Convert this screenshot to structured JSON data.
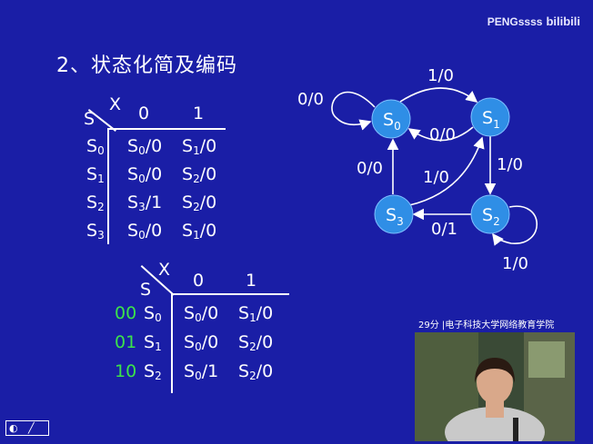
{
  "slide": {
    "title": "2、状态化简及编码",
    "watermark": {
      "text": "PENGssss",
      "logo": "bilibili"
    }
  },
  "table1": {
    "col_var": "X",
    "row_var": "S",
    "columns": [
      "0",
      "1"
    ],
    "rows": [
      {
        "state": "S",
        "state_sub": "0",
        "c0": "S",
        "c0_sub": "0",
        "c0_out": "/0",
        "c1": "S",
        "c1_sub": "1",
        "c1_out": "/0"
      },
      {
        "state": "S",
        "state_sub": "1",
        "c0": "S",
        "c0_sub": "0",
        "c0_out": "/0",
        "c1": "S",
        "c1_sub": "2",
        "c1_out": "/0"
      },
      {
        "state": "S",
        "state_sub": "2",
        "c0": "S",
        "c0_sub": "3",
        "c0_out": "/1",
        "c1": "S",
        "c1_sub": "2",
        "c1_out": "/0"
      },
      {
        "state": "S",
        "state_sub": "3",
        "c0": "S",
        "c0_sub": "0",
        "c0_out": "/0",
        "c1": "S",
        "c1_sub": "1",
        "c1_out": "/0"
      }
    ]
  },
  "table2": {
    "col_var": "X",
    "row_var": "S",
    "columns": [
      "0",
      "1"
    ],
    "rows": [
      {
        "code": "00",
        "state": "S",
        "state_sub": "0",
        "c0": "S",
        "c0_sub": "0",
        "c0_out": "/0",
        "c1": "S",
        "c1_sub": "1",
        "c1_out": "/0"
      },
      {
        "code": "01",
        "state": "S",
        "state_sub": "1",
        "c0": "S",
        "c0_sub": "0",
        "c0_out": "/0",
        "c1": "S",
        "c1_sub": "2",
        "c1_out": "/0"
      },
      {
        "code": "10",
        "state": "S",
        "state_sub": "2",
        "c0": "S",
        "c0_sub": "0",
        "c0_out": "/1",
        "c1": "S",
        "c1_sub": "2",
        "c1_out": "/0"
      }
    ]
  },
  "diagram": {
    "nodes": [
      {
        "id": "s0",
        "label": "S",
        "sub": "0"
      },
      {
        "id": "s1",
        "label": "S",
        "sub": "1"
      },
      {
        "id": "s2",
        "label": "S",
        "sub": "2"
      },
      {
        "id": "s3",
        "label": "S",
        "sub": "3"
      }
    ],
    "edges": {
      "s0_self": "0/0",
      "s0_s1": "1/0",
      "s1_s0": "0/0",
      "s1_s2": "1/0",
      "s3_s0": "0/0",
      "s3_s1": "1/0",
      "s2_s3": "0/1",
      "s2_self": "1/0"
    },
    "node_color": "#2f8ee6"
  },
  "video": {
    "caption": "29分 |电子科技大学网络教育学院"
  }
}
